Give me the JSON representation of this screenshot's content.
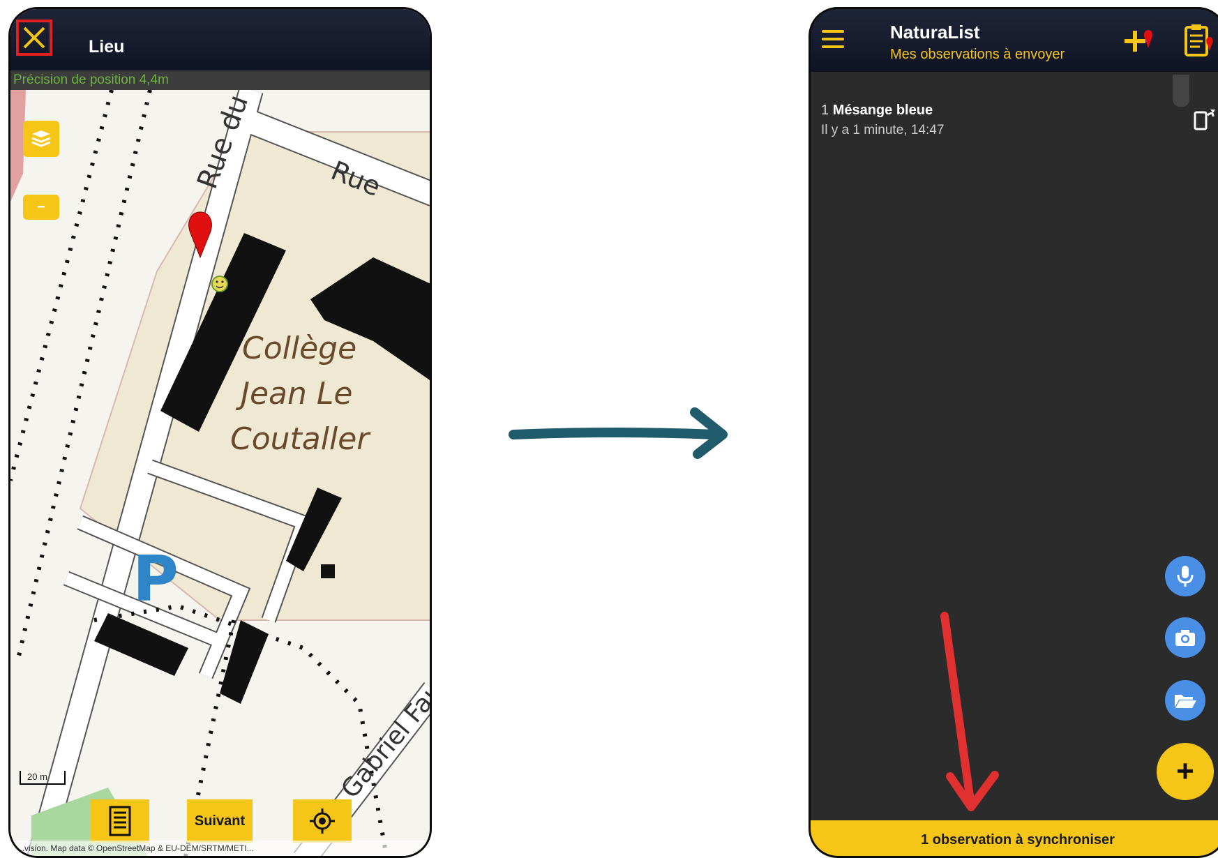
{
  "left_screen": {
    "title": "Lieu",
    "precision_text": "Précision de position 4,4m",
    "close_icon": "close-icon",
    "layers_icon": "layers-icon",
    "zoom_out_label": "−",
    "scale_label": "20 m",
    "map_labels": {
      "street_1": "Rue du",
      "street_2": "Rue",
      "street_3": "Gabriel Fauré",
      "school_line1": "Collège",
      "school_line2": "Jean Le",
      "school_line3": "Coutaller",
      "parking": "P"
    },
    "buttons": {
      "list_icon": "list-icon",
      "next_label": "Suivant",
      "locate_icon": "crosshair-icon"
    },
    "attribution": "...vision. Map data © OpenStreetMap & EU-DEM/SRTM/METI..."
  },
  "right_screen": {
    "app_name": "NaturaList",
    "subtitle": "Mes observations à envoyer",
    "menu_icon": "menu-icon",
    "add_observation_icon": "add-observation-icon",
    "clipboard_icon": "clipboard-icon",
    "observation": {
      "count": "1",
      "species": "Mésange bleue",
      "time": "Il y a 1 minute, 14:47"
    },
    "device_icon": "device-sync-icon",
    "fab_icons": [
      "microphone-icon",
      "camera-icon",
      "folder-icon"
    ],
    "add_label": "+",
    "sync_bar_text": "1 observation à synchroniser"
  },
  "colors": {
    "accent_yellow": "#f5c518",
    "topbar_dark": "#141a2b",
    "precision_green": "#6db33f",
    "fab_blue": "#4a8fe6",
    "arrow_teal": "#1f5b6b",
    "annotation_red": "#e03030"
  }
}
